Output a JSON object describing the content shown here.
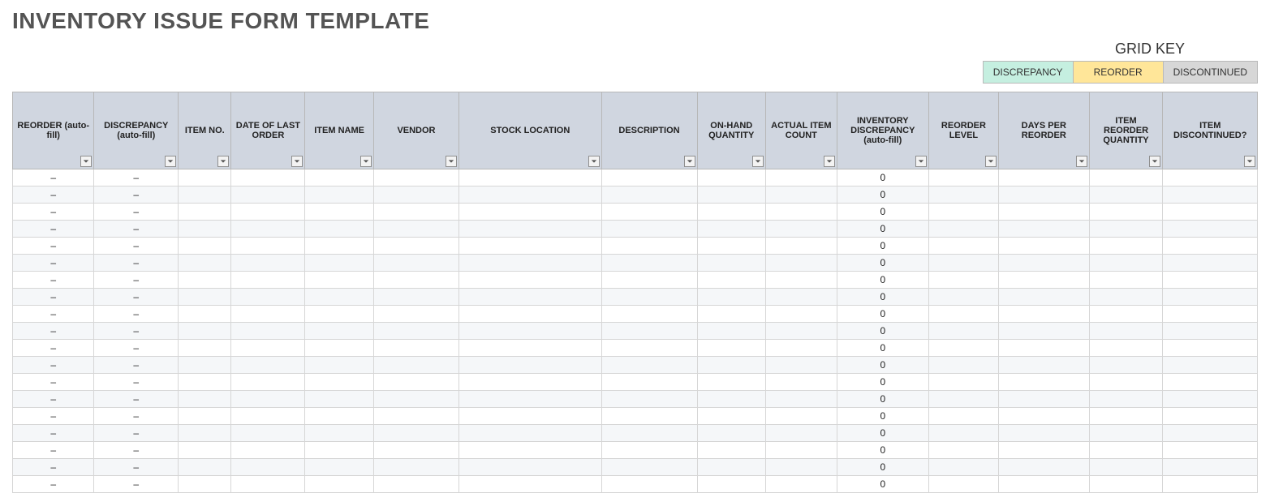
{
  "title": "INVENTORY ISSUE FORM TEMPLATE",
  "grid_key": {
    "label": "GRID KEY",
    "items": [
      {
        "label": "DISCREPANCY",
        "class": "gk-discrepancy"
      },
      {
        "label": "REORDER",
        "class": "gk-reorder"
      },
      {
        "label": "DISCONTINUED",
        "class": "gk-discontinued"
      }
    ]
  },
  "columns": [
    {
      "id": "reorder_autofill",
      "label": "REORDER (auto-fill)"
    },
    {
      "id": "discrepancy_autofill",
      "label": "DISCREPANCY (auto-fill)"
    },
    {
      "id": "item_no",
      "label": "ITEM NO."
    },
    {
      "id": "date_last_order",
      "label": "DATE OF LAST ORDER"
    },
    {
      "id": "item_name",
      "label": "ITEM NAME"
    },
    {
      "id": "vendor",
      "label": "VENDOR"
    },
    {
      "id": "stock_location",
      "label": "STOCK LOCATION"
    },
    {
      "id": "description",
      "label": "DESCRIPTION"
    },
    {
      "id": "on_hand_qty",
      "label": "ON-HAND QUANTITY"
    },
    {
      "id": "actual_item_count",
      "label": "ACTUAL ITEM COUNT"
    },
    {
      "id": "inv_discrepancy",
      "label": "INVENTORY DISCREPANCY (auto-fill)"
    },
    {
      "id": "reorder_level",
      "label": "REORDER LEVEL"
    },
    {
      "id": "days_per_reorder",
      "label": "DAYS PER REORDER"
    },
    {
      "id": "item_reorder_qty",
      "label": "ITEM REORDER QUANTITY"
    },
    {
      "id": "item_discontinued",
      "label": "ITEM DISCONTINUED?"
    }
  ],
  "row_count": 19,
  "default_cells": {
    "reorder_autofill": "–",
    "discrepancy_autofill": "–",
    "inv_discrepancy": "0"
  }
}
